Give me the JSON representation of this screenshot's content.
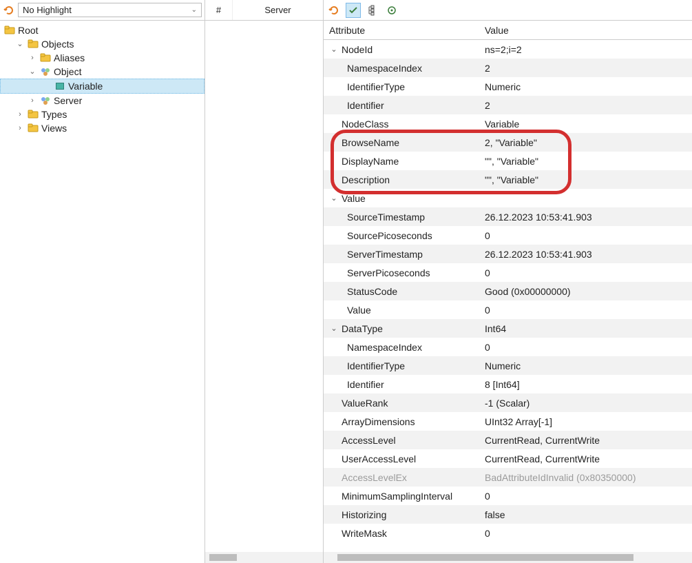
{
  "left": {
    "highlight_label": "No Highlight",
    "root": "Root",
    "objects": "Objects",
    "aliases": "Aliases",
    "object": "Object",
    "variable": "Variable",
    "server": "Server",
    "types": "Types",
    "views": "Views"
  },
  "mid": {
    "col_index": "#",
    "col_server": "Server"
  },
  "attr_header": {
    "attribute": "Attribute",
    "value": "Value"
  },
  "rows": [
    {
      "lvl": 1,
      "exp": "v",
      "a": "NodeId",
      "v": "ns=2;i=2",
      "alt": false
    },
    {
      "lvl": 2,
      "a": "NamespaceIndex",
      "v": "2",
      "alt": true
    },
    {
      "lvl": 2,
      "a": "IdentifierType",
      "v": "Numeric",
      "alt": false
    },
    {
      "lvl": 2,
      "a": "Identifier",
      "v": "2",
      "alt": true
    },
    {
      "lvl": 1,
      "a": "NodeClass",
      "v": "Variable",
      "alt": false
    },
    {
      "lvl": 1,
      "a": "BrowseName",
      "v": "2, \"Variable\"",
      "alt": true
    },
    {
      "lvl": 1,
      "a": "DisplayName",
      "v": "\"\", \"Variable\"",
      "alt": false
    },
    {
      "lvl": 1,
      "a": "Description",
      "v": "\"\", \"Variable\"",
      "alt": true
    },
    {
      "lvl": 1,
      "exp": "v",
      "a": "Value",
      "v": "",
      "alt": false
    },
    {
      "lvl": 2,
      "a": "SourceTimestamp",
      "v": "26.12.2023 10:53:41.903",
      "alt": true
    },
    {
      "lvl": 2,
      "a": "SourcePicoseconds",
      "v": "0",
      "alt": false
    },
    {
      "lvl": 2,
      "a": "ServerTimestamp",
      "v": "26.12.2023 10:53:41.903",
      "alt": true
    },
    {
      "lvl": 2,
      "a": "ServerPicoseconds",
      "v": "0",
      "alt": false
    },
    {
      "lvl": 2,
      "a": "StatusCode",
      "v": "Good (0x00000000)",
      "alt": true
    },
    {
      "lvl": 2,
      "a": "Value",
      "v": "0",
      "alt": false
    },
    {
      "lvl": 1,
      "exp": "v",
      "a": "DataType",
      "v": "Int64",
      "alt": true
    },
    {
      "lvl": 2,
      "a": "NamespaceIndex",
      "v": "0",
      "alt": false
    },
    {
      "lvl": 2,
      "a": "IdentifierType",
      "v": "Numeric",
      "alt": true
    },
    {
      "lvl": 2,
      "a": "Identifier",
      "v": "8 [Int64]",
      "alt": false
    },
    {
      "lvl": 1,
      "a": "ValueRank",
      "v": "-1 (Scalar)",
      "alt": true
    },
    {
      "lvl": 1,
      "a": "ArrayDimensions",
      "v": "UInt32 Array[-1]",
      "alt": false
    },
    {
      "lvl": 1,
      "a": "AccessLevel",
      "v": "CurrentRead, CurrentWrite",
      "alt": true
    },
    {
      "lvl": 1,
      "a": "UserAccessLevel",
      "v": "CurrentRead, CurrentWrite",
      "alt": false
    },
    {
      "lvl": 1,
      "a": "AccessLevelEx",
      "v": "BadAttributeIdInvalid (0x80350000)",
      "alt": true,
      "disabled": true
    },
    {
      "lvl": 1,
      "a": "MinimumSamplingInterval",
      "v": "0",
      "alt": false
    },
    {
      "lvl": 1,
      "a": "Historizing",
      "v": "false",
      "alt": true
    },
    {
      "lvl": 1,
      "a": "WriteMask",
      "v": "0",
      "alt": false
    }
  ]
}
